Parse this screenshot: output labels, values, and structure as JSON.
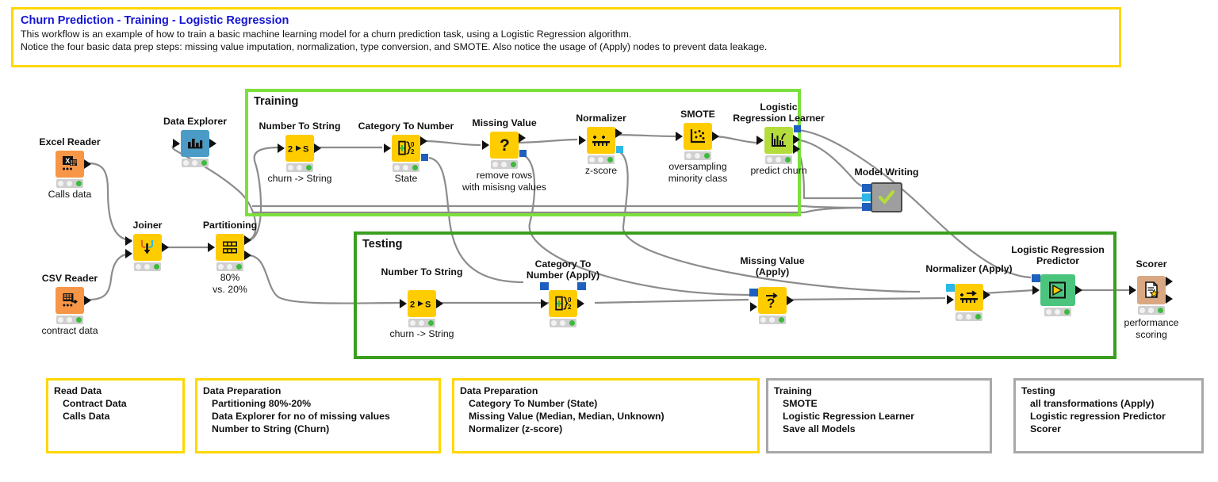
{
  "header": {
    "title": "Churn Prediction - Training - Logistic Regression",
    "lines": [
      "This workflow is an example of how to train a basic machine learning model for a churn prediction task, using a Logistic Regression algorithm.",
      "Notice the four basic data prep steps: missing value imputation, normalization, type conversion, and SMOTE. Also notice the usage of (Apply) nodes to prevent data leakage."
    ],
    "border_color": "#FFD700",
    "title_color": "#1414d2"
  },
  "groups": [
    {
      "label": "Training",
      "border_color": "#7CE03C"
    },
    {
      "label": "Testing",
      "border_color": "#3A9E1E"
    }
  ],
  "nodes": [
    {
      "id": "excel-reader",
      "label": "Excel Reader",
      "sub": "Calls data",
      "icon": "excel-reader-icon",
      "color": "#F79646"
    },
    {
      "id": "csv-reader",
      "label": "CSV Reader",
      "sub": "contract data",
      "icon": "csv-reader-icon",
      "color": "#F79646"
    },
    {
      "id": "data-explorer",
      "label": "Data Explorer",
      "sub": "",
      "icon": "data-explorer-icon",
      "color": "#4A9CC6"
    },
    {
      "id": "joiner",
      "label": "Joiner",
      "sub": "",
      "icon": "joiner-icon",
      "color": "#FFCC00"
    },
    {
      "id": "partitioning",
      "label": "Partitioning",
      "sub": "80%\nvs. 20%",
      "icon": "partitioning-icon",
      "color": "#FFCC00"
    },
    {
      "id": "num2str-train",
      "label": "Number To String",
      "sub": "churn -> String",
      "icon": "number-to-string-icon",
      "color": "#FFCC00"
    },
    {
      "id": "cat2num-train",
      "label": "Category To Number",
      "sub": "State",
      "icon": "category-to-number-icon",
      "color": "#FFCC00"
    },
    {
      "id": "missing-train",
      "label": "Missing Value",
      "sub": "remove rows\nwith misisng values",
      "icon": "missing-value-icon",
      "color": "#FFCC00"
    },
    {
      "id": "norm-train",
      "label": "Normalizer",
      "sub": "z-score",
      "icon": "normalizer-icon",
      "color": "#FFCC00"
    },
    {
      "id": "smote",
      "label": "SMOTE",
      "sub": "oversampling\nminority class",
      "icon": "smote-icon",
      "color": "#FFCC00"
    },
    {
      "id": "lr-learner",
      "label": "Logistic\nRegression Learner",
      "sub": "predict churn",
      "icon": "lr-learner-icon",
      "color": "#B4DC3C"
    },
    {
      "id": "model-writing",
      "label": "Model Writing",
      "sub": "",
      "icon": "metanode-check-icon",
      "color": "#9E9E9E"
    },
    {
      "id": "num2str-test",
      "label": "Number To String",
      "sub": "churn -> String",
      "icon": "number-to-string-icon",
      "color": "#FFCC00"
    },
    {
      "id": "cat2num-test",
      "label": "Category To\nNumber (Apply)",
      "sub": "",
      "icon": "category-to-number-icon",
      "color": "#FFCC00"
    },
    {
      "id": "missing-test",
      "label": "Missing Value\n(Apply)",
      "sub": "",
      "icon": "missing-value-apply-icon",
      "color": "#FFCC00"
    },
    {
      "id": "norm-test",
      "label": "Normalizer (Apply)",
      "sub": "",
      "icon": "normalizer-apply-icon",
      "color": "#FFCC00"
    },
    {
      "id": "lr-predictor",
      "label": "Logistic Regression\nPredictor",
      "sub": "",
      "icon": "predictor-icon",
      "color": "#4BC47D"
    },
    {
      "id": "scorer",
      "label": "Scorer",
      "sub": "performance\nscoring",
      "icon": "scorer-icon",
      "color": "#D9A882"
    }
  ],
  "node_labels": {
    "excel_reader": "Excel Reader",
    "excel_reader_sub": "Calls data",
    "csv_reader": "CSV Reader",
    "csv_reader_sub": "contract data",
    "data_explorer": "Data Explorer",
    "joiner": "Joiner",
    "partitioning": "Partitioning",
    "partitioning_sub1": "80%",
    "partitioning_sub2": "vs. 20%",
    "num2str_train": "Number To String",
    "num2str_train_sub": "churn -> String",
    "cat2num_train": "Category To Number",
    "cat2num_train_sub": "State",
    "missing_train": "Missing Value",
    "missing_train_sub1": "remove rows",
    "missing_train_sub2": "with misisng values",
    "norm_train": "Normalizer",
    "norm_train_sub": "z-score",
    "smote": "SMOTE",
    "smote_sub1": "oversampling",
    "smote_sub2": "minority class",
    "lr_learner_l1": "Logistic",
    "lr_learner_l2": "Regression Learner",
    "lr_learner_sub": "predict churn",
    "model_writing": "Model Writing",
    "num2str_test": "Number To String",
    "num2str_test_sub": "churn -> String",
    "cat2num_test_l1": "Category To",
    "cat2num_test_l2": "Number (Apply)",
    "missing_test_l1": "Missing Value",
    "missing_test_l2": "(Apply)",
    "norm_test": "Normalizer (Apply)",
    "lr_predictor_l1": "Logistic Regression",
    "lr_predictor_l2": "Predictor",
    "scorer": "Scorer",
    "scorer_sub1": "performance",
    "scorer_sub2": "scoring"
  },
  "annotations": [
    {
      "id": "read-data",
      "border": "yellow",
      "title": "Read Data",
      "items": [
        "Contract Data",
        "Calls Data"
      ]
    },
    {
      "id": "data-prep-1",
      "border": "yellow",
      "title": "Data Preparation",
      "items": [
        "Partitioning 80%-20%",
        "Data Explorer for no of missing values",
        "Number to String (Churn)"
      ]
    },
    {
      "id": "data-prep-2",
      "border": "yellow",
      "title": "Data Preparation",
      "items": [
        "Category To Number (State)",
        "Missing Value (Median, Median, Unknown)",
        "Normalizer (z-score)"
      ]
    },
    {
      "id": "training-summary",
      "border": "gray",
      "title": "Training",
      "items": [
        "SMOTE",
        "Logistic Regression Learner",
        "Save all Models"
      ]
    },
    {
      "id": "testing-summary",
      "border": "gray",
      "title": "Testing",
      "items": [
        "all transformations (Apply)",
        "Logistic regression Predictor",
        "Scorer"
      ]
    }
  ],
  "colors": {
    "wire": "#8c8c8c",
    "node_yellow": "#FFCC00",
    "node_orange": "#F79646",
    "node_blue": "#4A9CC6",
    "node_lime": "#B4DC3C",
    "node_green": "#4BC47D",
    "node_tan": "#D9A882",
    "node_gray": "#9E9E9E",
    "port_blue_dark": "#1F5FBF",
    "port_blue_light": "#2BB7E8",
    "status_green": "#3DBA3D",
    "annot_yellow": "#FFD700",
    "annot_gray": "#A8A8A8"
  }
}
